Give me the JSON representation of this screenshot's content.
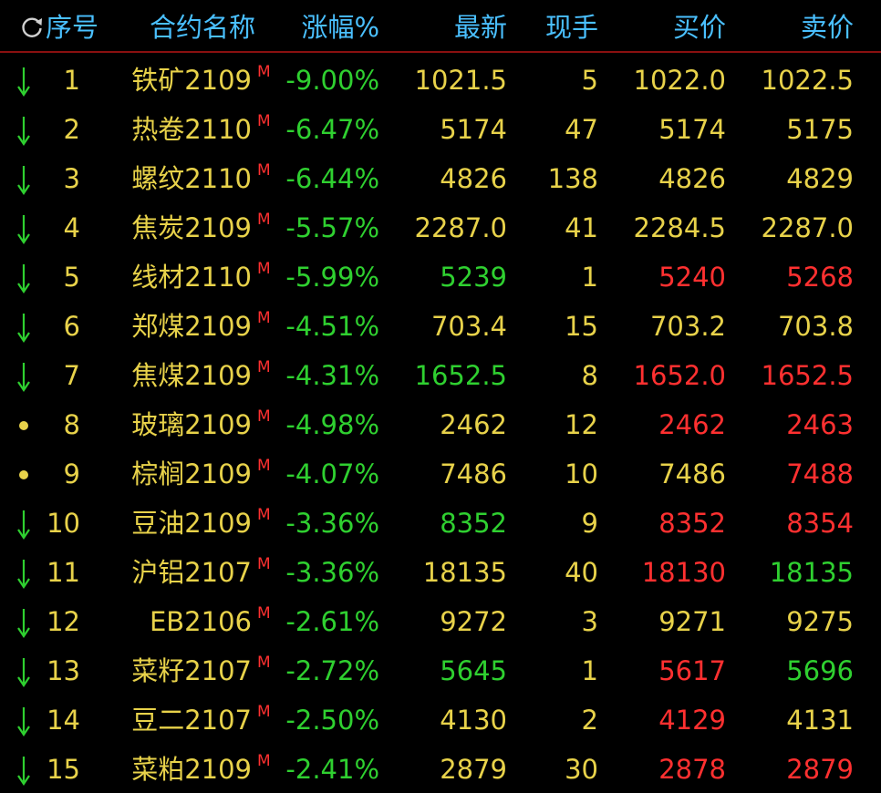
{
  "header": {
    "seq_label": "序号",
    "name_label": "合约名称",
    "change_label": "涨幅%",
    "last_label": "最新",
    "volume_label": "现手",
    "bid_label": "买价",
    "ask_label": "卖价"
  },
  "colors": {
    "yellow": "#e8d24a",
    "green": "#2fd030",
    "red": "#ff3030",
    "header_blue": "#4ac0ff",
    "background": "#000000"
  },
  "rows": [
    {
      "seq": "1",
      "name": "铁矿2109",
      "flag": "M",
      "change": "-9.00%",
      "last": "1021.5",
      "last_color": "yellow",
      "vol": "5",
      "bid": "1022.0",
      "bid_color": "yellow",
      "ask": "1022.5",
      "ask_color": "yellow",
      "trend": "down-arrow-icon"
    },
    {
      "seq": "2",
      "name": "热卷2110",
      "flag": "M",
      "change": "-6.47%",
      "last": "5174",
      "last_color": "yellow",
      "vol": "47",
      "bid": "5174",
      "bid_color": "yellow",
      "ask": "5175",
      "ask_color": "yellow",
      "trend": "down-arrow-icon"
    },
    {
      "seq": "3",
      "name": "螺纹2110",
      "flag": "M",
      "change": "-6.44%",
      "last": "4826",
      "last_color": "yellow",
      "vol": "138",
      "bid": "4826",
      "bid_color": "yellow",
      "ask": "4829",
      "ask_color": "yellow",
      "trend": "down-arrow-icon"
    },
    {
      "seq": "4",
      "name": "焦炭2109",
      "flag": "M",
      "change": "-5.57%",
      "last": "2287.0",
      "last_color": "yellow",
      "vol": "41",
      "bid": "2284.5",
      "bid_color": "yellow",
      "ask": "2287.0",
      "ask_color": "yellow",
      "trend": "down-arrow-icon"
    },
    {
      "seq": "5",
      "name": "线材2110",
      "flag": "M",
      "change": "-5.99%",
      "last": "5239",
      "last_color": "green",
      "vol": "1",
      "bid": "5240",
      "bid_color": "red",
      "ask": "5268",
      "ask_color": "red",
      "trend": "down-arrow-icon"
    },
    {
      "seq": "6",
      "name": "郑煤2109",
      "flag": "M",
      "change": "-4.51%",
      "last": "703.4",
      "last_color": "yellow",
      "vol": "15",
      "bid": "703.2",
      "bid_color": "yellow",
      "ask": "703.8",
      "ask_color": "yellow",
      "trend": "down-arrow-icon"
    },
    {
      "seq": "7",
      "name": "焦煤2109",
      "flag": "M",
      "change": "-4.31%",
      "last": "1652.5",
      "last_color": "green",
      "vol": "8",
      "bid": "1652.0",
      "bid_color": "red",
      "ask": "1652.5",
      "ask_color": "red",
      "trend": "down-arrow-icon"
    },
    {
      "seq": "8",
      "name": "玻璃2109",
      "flag": "M",
      "change": "-4.98%",
      "last": "2462",
      "last_color": "yellow",
      "vol": "12",
      "bid": "2462",
      "bid_color": "red",
      "ask": "2463",
      "ask_color": "red",
      "trend": "dot-icon"
    },
    {
      "seq": "9",
      "name": "棕榈2109",
      "flag": "M",
      "change": "-4.07%",
      "last": "7486",
      "last_color": "yellow",
      "vol": "10",
      "bid": "7486",
      "bid_color": "yellow",
      "ask": "7488",
      "ask_color": "red",
      "trend": "dot-icon"
    },
    {
      "seq": "10",
      "name": "豆油2109",
      "flag": "M",
      "change": "-3.36%",
      "last": "8352",
      "last_color": "green",
      "vol": "9",
      "bid": "8352",
      "bid_color": "red",
      "ask": "8354",
      "ask_color": "red",
      "trend": "down-arrow-icon"
    },
    {
      "seq": "11",
      "name": "沪铝2107",
      "flag": "M",
      "change": "-3.36%",
      "last": "18135",
      "last_color": "yellow",
      "vol": "40",
      "bid": "18130",
      "bid_color": "red",
      "ask": "18135",
      "ask_color": "green",
      "trend": "down-arrow-icon"
    },
    {
      "seq": "12",
      "name": "EB2106",
      "flag": "M",
      "change": "-2.61%",
      "last": "9272",
      "last_color": "yellow",
      "vol": "3",
      "bid": "9271",
      "bid_color": "yellow",
      "ask": "9275",
      "ask_color": "yellow",
      "trend": "down-arrow-icon"
    },
    {
      "seq": "13",
      "name": "菜籽2107",
      "flag": "M",
      "change": "-2.72%",
      "last": "5645",
      "last_color": "green",
      "vol": "1",
      "bid": "5617",
      "bid_color": "red",
      "ask": "5696",
      "ask_color": "green",
      "trend": "down-arrow-icon"
    },
    {
      "seq": "14",
      "name": "豆二2107",
      "flag": "M",
      "change": "-2.50%",
      "last": "4130",
      "last_color": "yellow",
      "vol": "2",
      "bid": "4129",
      "bid_color": "red",
      "ask": "4131",
      "ask_color": "yellow",
      "trend": "down-arrow-icon"
    },
    {
      "seq": "15",
      "name": "菜粕2109",
      "flag": "M",
      "change": "-2.41%",
      "last": "2879",
      "last_color": "yellow",
      "vol": "30",
      "bid": "2878",
      "bid_color": "red",
      "ask": "2879",
      "ask_color": "red",
      "trend": "down-arrow-icon"
    }
  ]
}
